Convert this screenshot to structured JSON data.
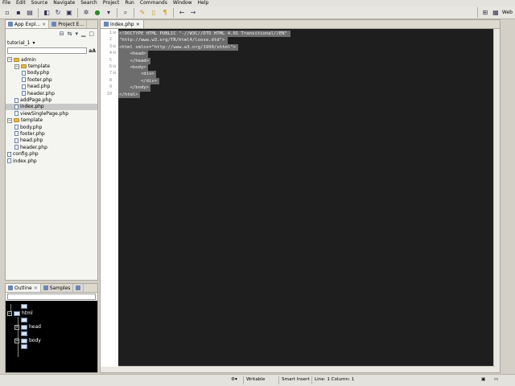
{
  "menu": [
    "File",
    "Edit",
    "Source",
    "Navigate",
    "Search",
    "Project",
    "Run",
    "Commands",
    "Window",
    "Help"
  ],
  "perspective": {
    "label": "Web"
  },
  "left_top": {
    "tabs": [
      {
        "label": "App Expl...",
        "close": "×"
      },
      {
        "label": "Project E...",
        "close": ""
      }
    ],
    "project": {
      "name": "tutorial_1",
      "arrow": "▾"
    },
    "search": {
      "placeholder": "",
      "button": "aA"
    },
    "tree": [
      {
        "label": "admin",
        "kind": "folder",
        "depth": 0,
        "toggle": "−"
      },
      {
        "label": "template",
        "kind": "folder",
        "depth": 1,
        "toggle": "−"
      },
      {
        "label": "body.php",
        "kind": "file",
        "depth": 2
      },
      {
        "label": "footer.php",
        "kind": "file",
        "depth": 2
      },
      {
        "label": "head.php",
        "kind": "file",
        "depth": 2
      },
      {
        "label": "header.php",
        "kind": "file",
        "depth": 2
      },
      {
        "label": "addPage.php",
        "kind": "file",
        "depth": 1
      },
      {
        "label": "index.php",
        "kind": "file",
        "depth": 1,
        "selected": true
      },
      {
        "label": "viewSinglePage.php",
        "kind": "file",
        "depth": 1
      },
      {
        "label": "template",
        "kind": "folder",
        "depth": 0,
        "toggle": "−"
      },
      {
        "label": "body.php",
        "kind": "file",
        "depth": 1
      },
      {
        "label": "footer.php",
        "kind": "file",
        "depth": 1
      },
      {
        "label": "head.php",
        "kind": "file",
        "depth": 1
      },
      {
        "label": "header.php",
        "kind": "file",
        "depth": 1
      },
      {
        "label": "config.php",
        "kind": "file",
        "depth": 0
      },
      {
        "label": "index.php",
        "kind": "file",
        "depth": 0
      }
    ]
  },
  "left_bottom": {
    "tabs": [
      {
        "label": "Outline",
        "close": "×"
      },
      {
        "label": "Samples",
        "close": ""
      },
      {
        "label": "",
        "close": ""
      }
    ],
    "outline": [
      {
        "label": "",
        "depth": 1
      },
      {
        "label": "html",
        "depth": 0,
        "toggle": "−"
      },
      {
        "label": "",
        "depth": 1
      },
      {
        "label": "head",
        "depth": 1,
        "toggle": "+"
      },
      {
        "label": "",
        "depth": 1
      },
      {
        "label": "body",
        "depth": 1,
        "toggle": "+"
      },
      {
        "label": "",
        "depth": 1
      }
    ]
  },
  "editor": {
    "tab": {
      "label": "index.php",
      "close": "×"
    },
    "lines": [
      "<!DOCTYPE HTML PUBLIC \"-//W3C//DTD HTML 4.01 Transitional//EN\"",
      "\"http://www.w3.org/TR/html4/loose.dtd\">",
      "<html xmlns=\"http://www.w3.org/1999/xhtml\">",
      "    <head>",
      "    </head>",
      "    <body>",
      "        <div>",
      "        </div>",
      "    </body>",
      "</html>"
    ],
    "line_numbers": [
      "1",
      "2",
      "3",
      "4",
      "5",
      "6",
      "7",
      "8",
      "9",
      "10"
    ],
    "fold_markers": [
      "⊖",
      "",
      "⊖",
      "⊖",
      "",
      "⊖",
      "⊖",
      "",
      "",
      ""
    ]
  },
  "status": {
    "writable": "Writable",
    "insert": "Smart Insert",
    "position": "Line: 1 Column: 1"
  },
  "colors": {
    "editor_bg": "#1e1e1e",
    "selection": "#6d6d6d",
    "chrome": "#d4d0c8",
    "folder": "#e3b74a"
  }
}
